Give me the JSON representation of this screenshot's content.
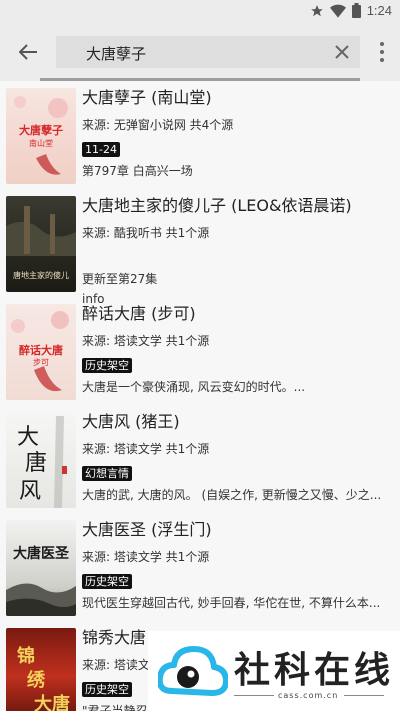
{
  "status": {
    "time": "1:24"
  },
  "search": {
    "query": "大唐孽子"
  },
  "results": [
    {
      "title": "大唐孽子 (南山堂)",
      "source": "来源:   无弹窗小说网  共4个源",
      "tag": "11-24",
      "desc": "第797章 白高兴一场",
      "extra": ""
    },
    {
      "title": "大唐地主家的傻儿子 (LEO&依语晨诺)",
      "source": "来源: 酷我听书  共1个源",
      "tag": "",
      "desc": "更新至第27集",
      "extra": "info"
    },
    {
      "title": "醉话大唐 (步可)",
      "source": "来源: 塔读文学  共1个源",
      "tag": "历史架空",
      "desc": "大唐是一个豪侠涌现, 风云变幻的时代。...",
      "extra": ""
    },
    {
      "title": "大唐风 (猪王)",
      "source": "来源: 塔读文学  共1个源",
      "tag": "幻想言情",
      "desc": "大唐的武, 大唐的风。 (自娱之作, 更新慢之又慢、少之...",
      "extra": ""
    },
    {
      "title": "大唐医圣 (浮生门)",
      "source": "来源: 塔读文学  共1个源",
      "tag": "历史架空",
      "desc": "现代医生穿越回古代, 妙手回春, 华佗在世, 不算什么本...",
      "extra": ""
    },
    {
      "title": "锦秀大唐",
      "source": "来源: 塔读文",
      "tag": "历史架空",
      "desc": "\"君子当静忍",
      "extra": ""
    }
  ],
  "covers": [
    {
      "text": "大唐孽子",
      "sub": "南山堂"
    },
    {
      "text": "唐地主家的傻儿",
      "sub": ""
    },
    {
      "text": "醉话大唐",
      "sub": "步可"
    },
    {
      "text": "大唐风",
      "sub": ""
    },
    {
      "text": "大唐医圣",
      "sub": ""
    },
    {
      "text": "锦绣大唐",
      "sub": ""
    }
  ],
  "watermark": {
    "name": "社科在线",
    "url": "cass.com.cn"
  },
  "colors": {
    "accent_red": "#d62828",
    "tag_bg": "#111111"
  }
}
